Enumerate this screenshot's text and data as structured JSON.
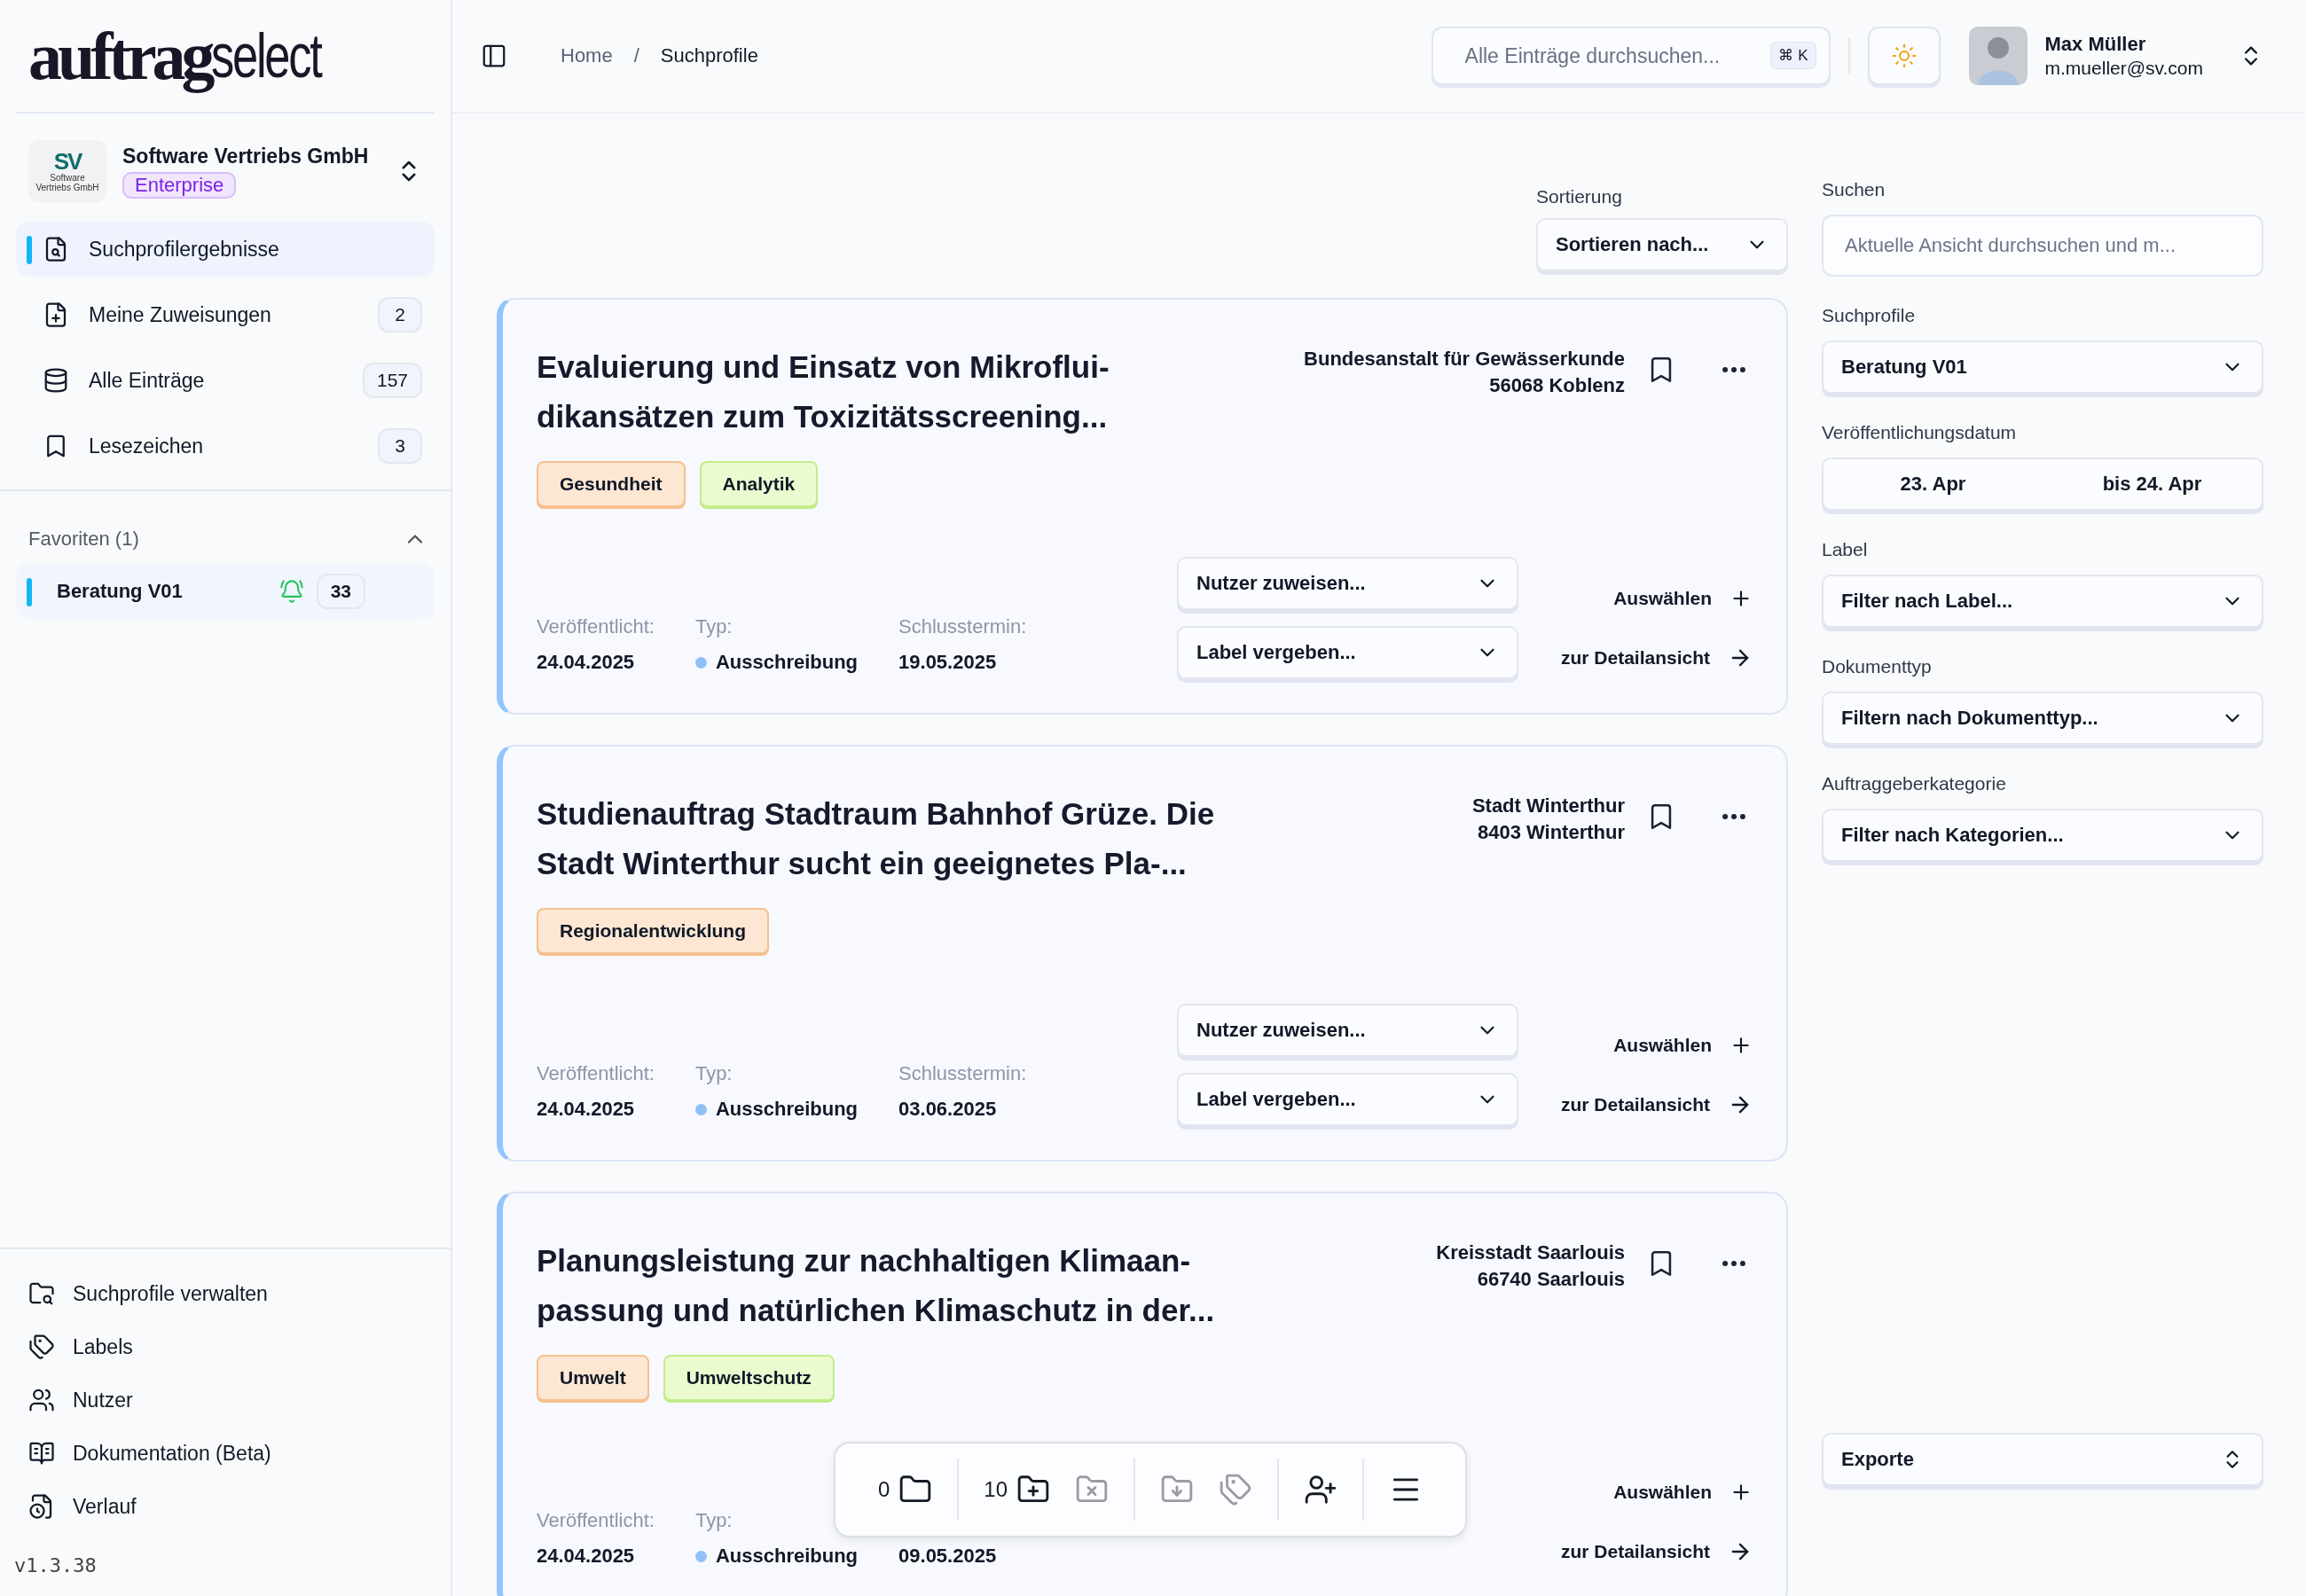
{
  "logo": {
    "part_1": "auftrag",
    "part_2": "select"
  },
  "organization": {
    "logo_text": "SV",
    "logo_caption_1": "Software",
    "logo_caption_2": "Vertriebs GmbH",
    "name": "Software Vertriebs GmbH",
    "plan": "Enterprise"
  },
  "nav": [
    {
      "label": "Suchprofilergebnisse",
      "selected": true
    },
    {
      "label": "Meine Zuweisungen",
      "count": "2",
      "selected": false
    },
    {
      "label": "Alle Einträge",
      "count": "157",
      "selected": false
    },
    {
      "label": "Lesezeichen",
      "count": "3",
      "selected": false
    }
  ],
  "favorites": {
    "title": "Favoriten (1)",
    "expanded": true,
    "items": [
      {
        "label": "Beratung V01",
        "count": "33",
        "selected": true
      }
    ]
  },
  "footer_nav": [
    {
      "label": "Suchprofile verwalten"
    },
    {
      "label": "Labels"
    },
    {
      "label": "Nutzer"
    },
    {
      "label": "Dokumentation (Beta)"
    },
    {
      "label": "Verlauf"
    }
  ],
  "version": "v1.3.38",
  "breadcrumb": {
    "items": [
      "Home",
      "Suchprofile"
    ],
    "separator": "/"
  },
  "global_search": {
    "placeholder": "Alle Einträge durchsuchen...",
    "shortcut": "⌘ K"
  },
  "user": {
    "name": "Max Müller",
    "email": "m.mueller@sv.com"
  },
  "sort": {
    "label": "Sortierung",
    "placeholder": "Sortieren nach..."
  },
  "results": [
    {
      "title_lines": [
        "Evaluierung und Einsatz von Mikroflui-",
        "dikansätzen zum Toxizitätsscreening..."
      ],
      "organization": "Bundesanstalt für Gewässerkunde",
      "city": "56068 Koblenz",
      "tags": [
        {
          "label": "Gesundheit",
          "color": "#fde7d3"
        },
        {
          "label": "Analytik",
          "color": "#ebfbcf"
        }
      ],
      "published_label": "Veröffentlicht:",
      "published": "24.04.2025",
      "type_label": "Typ:",
      "type": "Ausschreibung",
      "deadline_label": "Schlusstermin:",
      "deadline": "19.05.2025",
      "assign_placeholder": "Nutzer zuweisen...",
      "label_placeholder": "Label vergeben...",
      "select_action": "Auswählen",
      "detail_action": "zur Detailansicht"
    },
    {
      "title_lines": [
        "Studienauftrag Stadtraum Bahnhof Grüze. Die",
        "Stadt Winterthur sucht ein geeignetes Pla-..."
      ],
      "organization": "Stadt Winterthur",
      "city": "8403 Winterthur",
      "tags": [
        {
          "label": "Regionalentwicklung",
          "color": "#fde7d3"
        }
      ],
      "published_label": "Veröffentlicht:",
      "published": "24.04.2025",
      "type_label": "Typ:",
      "type": "Ausschreibung",
      "deadline_label": "Schlusstermin:",
      "deadline": "03.06.2025",
      "assign_placeholder": "Nutzer zuweisen...",
      "label_placeholder": "Label vergeben...",
      "select_action": "Auswählen",
      "detail_action": "zur Detailansicht"
    },
    {
      "title_lines": [
        "Planungsleistung zur nachhaltigen Klimaan-",
        "passung und natürlichen Klimaschutz in der..."
      ],
      "organization": "Kreisstadt Saarlouis",
      "city": "66740 Saarlouis",
      "tags": [
        {
          "label": "Umwelt",
          "color": "#fde7d3"
        },
        {
          "label": "Umweltschutz",
          "color": "#ebfbcf"
        }
      ],
      "published_label": "Veröffentlicht:",
      "published": "24.04.2025",
      "type_label": "Typ:",
      "type": "Ausschreibung",
      "deadline": "09.05.2025",
      "select_action": "Auswählen",
      "detail_action": "zur Detailansicht"
    }
  ],
  "toolbar": [
    [
      {
        "count": "0",
        "disabled": false
      }
    ],
    [
      {
        "count": "10",
        "disabled": false
      },
      {
        "disabled": true
      }
    ],
    [
      {
        "disabled": true
      },
      {
        "disabled": true
      }
    ],
    [
      {
        "disabled": false
      }
    ],
    [
      {
        "disabled": false
      }
    ]
  ],
  "filters": {
    "search": {
      "label": "Suchen",
      "placeholder": "Aktuelle Ansicht durchsuchen und m..."
    },
    "profile": {
      "label": "Suchprofile",
      "value": "Beratung V01"
    },
    "date": {
      "label": "Veröffentlichungsdatum",
      "from": "23. Apr",
      "to": "bis 24. Apr"
    },
    "label": {
      "label": "Label",
      "placeholder": "Filter nach Label..."
    },
    "doctype": {
      "label": "Dokumenttyp",
      "placeholder": "Filtern nach Dokumenttyp..."
    },
    "category": {
      "label": "Auftraggeberkategorie",
      "placeholder": "Filter nach Kategorien..."
    }
  },
  "exports": "Exporte"
}
